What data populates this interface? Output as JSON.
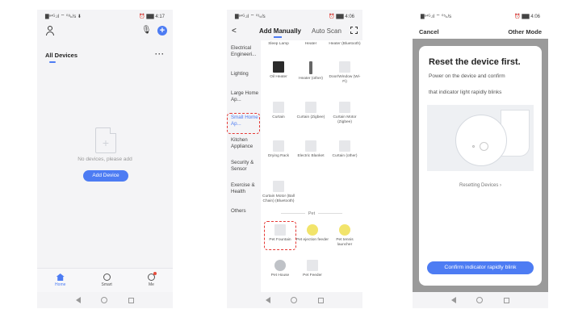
{
  "colors": {
    "accent": "#4d7cf3",
    "highlight": "#e53935"
  },
  "phone1": {
    "status": {
      "left": "▇ᵃ⁴ᴳ.ıl ⌔ ⁰⁸ₖ/s ⬇",
      "right": "⏰ ▇▇ 4:17"
    },
    "section_title": "All Devices",
    "more": "···",
    "empty_text": "No devices, please add",
    "add_button": "Add Device",
    "tabs": [
      {
        "label": "Home"
      },
      {
        "label": "Smart"
      },
      {
        "label": "Me"
      }
    ]
  },
  "phone2": {
    "status": {
      "left": "▇ᵃ⁴ᴳ.ıl ⌔ ⁰¹ₖ/s",
      "right": "⏰ ▇▇ 4:06"
    },
    "back": "<",
    "tab_manual": "Add Manually",
    "tab_scan": "Auto Scan",
    "categories": [
      {
        "label": "Electrical Engineeri..."
      },
      {
        "label": "Lighting"
      },
      {
        "label": "Large Home Ap..."
      },
      {
        "label": "Small Home Ap..."
      },
      {
        "label": "Kitchen Appliance"
      },
      {
        "label": "Security & Sensor"
      },
      {
        "label": "Exercise & Health"
      },
      {
        "label": "Others"
      }
    ],
    "devices": [
      {
        "label": "Sleep Lamp"
      },
      {
        "label": "Heater"
      },
      {
        "label": "Heater (Bluetooth)"
      },
      {
        "label": "Oil Heater"
      },
      {
        "label": "Heater (other)"
      },
      {
        "label": "Door/Window (Wi-Fi)"
      },
      {
        "label": "Curtain"
      },
      {
        "label": "Curtain (Zigbee)"
      },
      {
        "label": "Curtain Motor (Zigbee)"
      },
      {
        "label": "Drying Rack"
      },
      {
        "label": "Electric Blanket"
      },
      {
        "label": "Curtain (other)"
      },
      {
        "label": "Curtain Motor (Ball Chain) (Bluetooth)"
      }
    ],
    "pet_section": "Pet",
    "pet_devices": [
      {
        "label": "Pet Fountain"
      },
      {
        "label": "Pet ejection feeder"
      },
      {
        "label": "Pet tennis launcher"
      },
      {
        "label": "Pet House"
      },
      {
        "label": "Pet Feeder"
      }
    ]
  },
  "phone3": {
    "status": {
      "left": "▇ᵃ⁴ᴳ.ıl ⌔ ⁰⁵ₖ/s",
      "right": "⏰ ▇▇ 4:06"
    },
    "cancel": "Cancel",
    "other_mode": "Other Mode",
    "title": "Reset the device first.",
    "desc1": "Power on the device and confirm",
    "desc2": "that indicator light rapidly blinks",
    "resetting": "Resetting Devices  ›",
    "confirm": "Confirm indicator rapidly blink"
  }
}
